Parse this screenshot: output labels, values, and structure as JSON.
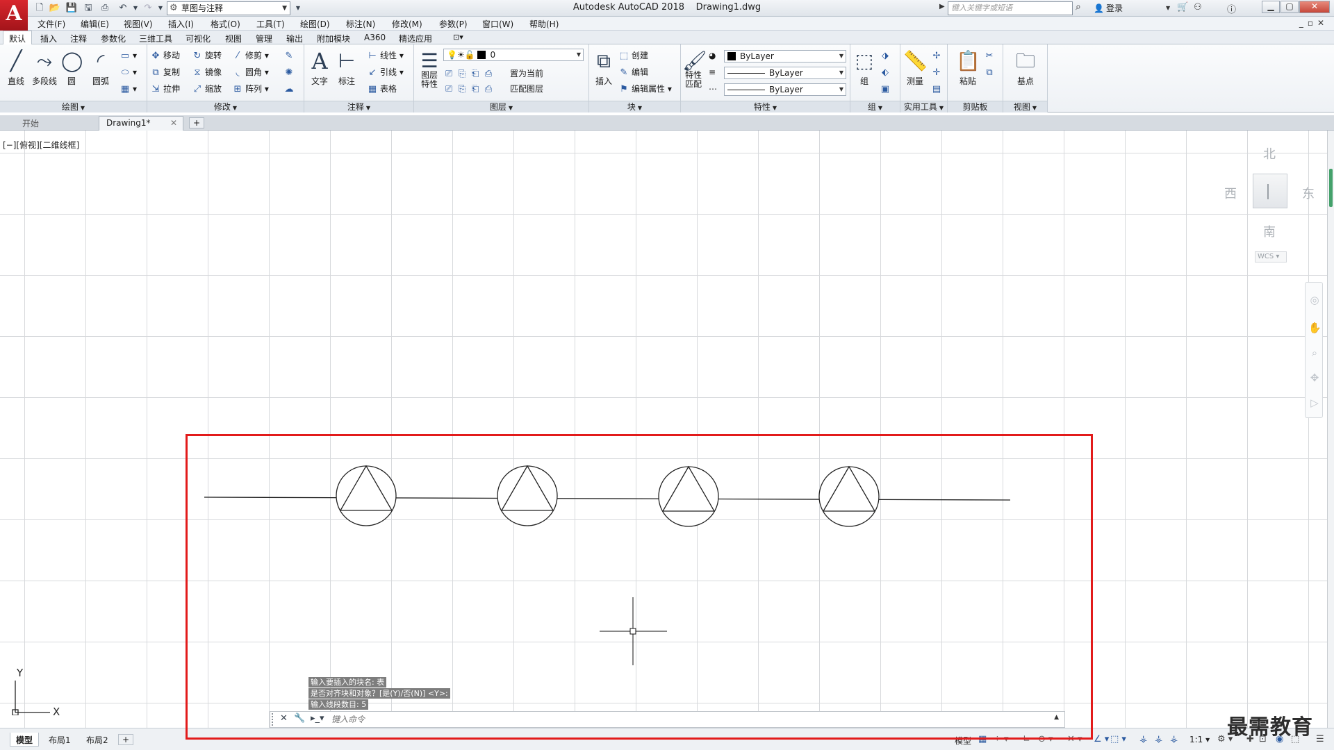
{
  "title_bar": {
    "logo": "A",
    "workspace": "草图与注释",
    "window_title": "Autodesk AutoCAD 2018    Drawing1.dwg",
    "search_placeholder": "键入关键字或短语",
    "login": "登录"
  },
  "menu": [
    "文件(F)",
    "编辑(E)",
    "视图(V)",
    "插入(I)",
    "格式(O)",
    "工具(T)",
    "绘图(D)",
    "标注(N)",
    "修改(M)",
    "参数(P)",
    "窗口(W)",
    "帮助(H)"
  ],
  "ribbon_tabs": [
    "默认",
    "插入",
    "注释",
    "参数化",
    "三维工具",
    "可视化",
    "视图",
    "管理",
    "输出",
    "附加模块",
    "A360",
    "精选应用"
  ],
  "ribbon": {
    "draw": {
      "label": "绘图",
      "line": "直线",
      "polyline": "多段线",
      "circle": "圆",
      "arc": "圆弧"
    },
    "modify": {
      "label": "修改",
      "move": "移动",
      "rotate": "旋转",
      "trim": "修剪",
      "copy": "复制",
      "mirror": "镜像",
      "fillet": "圆角",
      "stretch": "拉伸",
      "scale": "缩放",
      "array": "阵列"
    },
    "annotation": {
      "label": "注释",
      "text": "文字",
      "dimension": "标注",
      "linear": "线性",
      "leader": "引线",
      "table": "表格"
    },
    "layers": {
      "label": "图层",
      "layer_props": "图层\n特性",
      "current_layer": "0",
      "set_current": "置为当前",
      "match_layer": "匹配图层"
    },
    "block": {
      "label": "块",
      "insert": "插入",
      "create": "创建",
      "edit": "编辑",
      "edit_attr": "编辑属性"
    },
    "properties": {
      "label": "特性",
      "match": "特性\n匹配",
      "color": "ByLayer",
      "linetype": "ByLayer",
      "lineweight": "ByLayer"
    },
    "groups": {
      "label": "组",
      "group": "组"
    },
    "utilities": {
      "label": "实用工具",
      "measure": "测量"
    },
    "clipboard": {
      "label": "剪贴板",
      "paste": "粘贴"
    },
    "view": {
      "label": "视图",
      "base": "基点"
    }
  },
  "file_tabs": [
    "开始",
    "Drawing1*"
  ],
  "viewport_label": "[−][俯视][二维线框]",
  "viewcube": {
    "north": "北",
    "south": "南",
    "east": "东",
    "west": "西",
    "wcs": "WCS"
  },
  "ucs": {
    "x": "X",
    "y": "Y"
  },
  "command": {
    "history": [
      "输入要插入的块名: 表",
      "是否对齐块和对象？[是(Y)/否(N)] <Y>:",
      "输入线段数目: 5"
    ],
    "placeholder": "键入命令"
  },
  "layout_tabs": [
    "模型",
    "布局1",
    "布局2"
  ],
  "status": {
    "model": "模型",
    "scale": "1:1"
  },
  "watermark": "最需教育",
  "colors": {
    "accent_red": "#e21b1b",
    "brand": "#c1151c",
    "grid": "#d7d9dc"
  }
}
